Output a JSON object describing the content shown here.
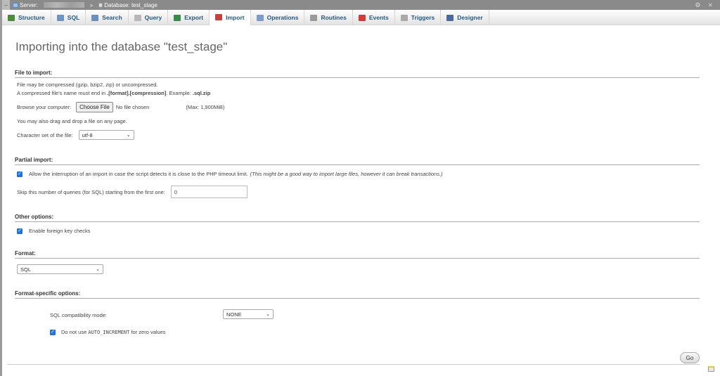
{
  "breadcrumb": {
    "server_label": "Server:",
    "separator": "»",
    "database_label": "Database: test_stage"
  },
  "tabs": [
    {
      "label": "Structure",
      "icon": "structure-icon",
      "color": "#4a8b3a"
    },
    {
      "label": "SQL",
      "icon": "sql-icon",
      "color": "#6d93c8"
    },
    {
      "label": "Search",
      "icon": "search-icon",
      "color": "#6a8fc0"
    },
    {
      "label": "Query",
      "icon": "query-icon",
      "color": "#b8b8b8"
    },
    {
      "label": "Export",
      "icon": "export-icon",
      "color": "#3a8a4a"
    },
    {
      "label": "Import",
      "icon": "import-icon",
      "color": "#c94040",
      "active": true
    },
    {
      "label": "Operations",
      "icon": "wrench-icon",
      "color": "#7b9ccc"
    },
    {
      "label": "Routines",
      "icon": "routines-icon",
      "color": "#9a9a9a"
    },
    {
      "label": "Events",
      "icon": "clock-icon",
      "color": "#d43a3a"
    },
    {
      "label": "Triggers",
      "icon": "triggers-icon",
      "color": "#aaaaaa"
    },
    {
      "label": "Designer",
      "icon": "designer-icon",
      "color": "#4a6a9a"
    }
  ],
  "page_title": "Importing into the database \"test_stage\"",
  "file_to_import": {
    "heading": "File to import:",
    "line1": "File may be compressed (gzip, bzip2, zip) or uncompressed.",
    "line2_prefix": "A compressed file's name must end in ",
    "line2_bold": ".[format].[compression]",
    "line2_mid": ". Example: ",
    "line2_example": ".sql.zip",
    "browse_label": "Browse your computer:",
    "choose_button": "Choose File",
    "no_file": "No file chosen",
    "max_size": "(Max: 1,900MiB)",
    "drag_drop": "You may also drag and drop a file on any page.",
    "charset_label": "Character set of the file:",
    "charset_value": "utf-8"
  },
  "partial_import": {
    "heading": "Partial import:",
    "allow_interrupt_label": "Allow the interruption of an import in case the script detects it is close to the PHP timeout limit.",
    "allow_interrupt_note": "(This might be a good way to import large files, however it can break transactions.)",
    "allow_interrupt_checked": true,
    "skip_label": "Skip this number of queries (for SQL) starting from the first one:",
    "skip_value": "0"
  },
  "other_options": {
    "heading": "Other options:",
    "fk_label": "Enable foreign key checks",
    "fk_checked": true
  },
  "format": {
    "heading": "Format:",
    "value": "SQL"
  },
  "format_specific": {
    "heading": "Format-specific options:",
    "compat_label": "SQL compatibility mode:",
    "compat_value": "NONE",
    "auto_inc_prefix": "Do not use ",
    "auto_inc_code": "AUTO_INCREMENT",
    "auto_inc_suffix": " for zero values",
    "auto_inc_checked": true
  },
  "go_button": "Go",
  "topbar_icons": {
    "settings": "gear-icon",
    "collapse": "collapse-up-icon"
  }
}
